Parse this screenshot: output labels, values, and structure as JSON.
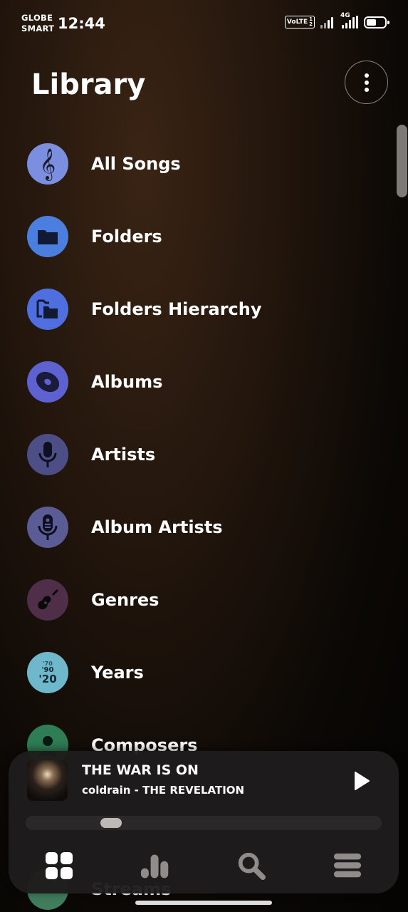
{
  "status_bar": {
    "carrier_line1": "GLOBE",
    "carrier_line2": "SMART",
    "time": "12:44",
    "volte": "VoLTE",
    "sim_top": "1",
    "sim_bottom": "2",
    "network": "4G"
  },
  "header": {
    "title": "Library",
    "menu_icon": "more-vertical-icon"
  },
  "library_items": [
    {
      "label": "All Songs",
      "icon": "treble-clef-icon",
      "color": "#7b8ee0"
    },
    {
      "label": "Folders",
      "icon": "folder-icon",
      "color": "#4a7fe0"
    },
    {
      "label": "Folders Hierarchy",
      "icon": "folders-hierarchy-icon",
      "color": "#4f6fe0"
    },
    {
      "label": "Albums",
      "icon": "album-disc-icon",
      "color": "#5d62d0"
    },
    {
      "label": "Artists",
      "icon": "microphone-icon",
      "color": "#4e4e86"
    },
    {
      "label": "Album Artists",
      "icon": "album-artist-mic-icon",
      "color": "#5b5c96"
    },
    {
      "label": "Genres",
      "icon": "guitar-icon",
      "color": "#4e2e48"
    },
    {
      "label": "Years",
      "icon": "years-icon",
      "color": "#6fb8cc",
      "years_text": [
        "'70",
        "'90",
        "'20"
      ]
    },
    {
      "label": "Composers",
      "icon": "composer-person-icon",
      "color": "#2e7d55"
    },
    {
      "label": "Streams",
      "icon": "streams-icon",
      "color": "#3f7d5c"
    }
  ],
  "now_playing": {
    "title": "THE WAR IS ON",
    "subtitle": "coldrain - THE REVELATION",
    "progress": 0.24,
    "play_icon": "play-icon"
  },
  "bottom_nav": [
    {
      "name": "library",
      "icon": "grid-icon"
    },
    {
      "name": "charts",
      "icon": "bar-chart-icon"
    },
    {
      "name": "search",
      "icon": "search-icon"
    },
    {
      "name": "queue",
      "icon": "list-icon"
    }
  ]
}
